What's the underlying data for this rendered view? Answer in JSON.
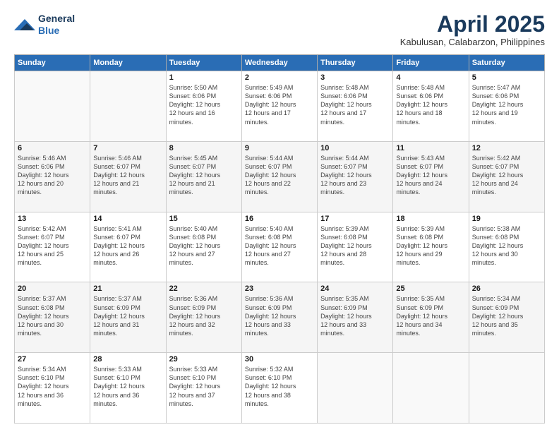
{
  "header": {
    "logo_line1": "General",
    "logo_line2": "Blue",
    "title": "April 2025",
    "location": "Kabulusan, Calabarzon, Philippines"
  },
  "weekdays": [
    "Sunday",
    "Monday",
    "Tuesday",
    "Wednesday",
    "Thursday",
    "Friday",
    "Saturday"
  ],
  "weeks": [
    [
      {
        "day": "",
        "info": ""
      },
      {
        "day": "",
        "info": ""
      },
      {
        "day": "1",
        "sunrise": "5:50 AM",
        "sunset": "6:06 PM",
        "daylight": "12 hours and 16 minutes."
      },
      {
        "day": "2",
        "sunrise": "5:49 AM",
        "sunset": "6:06 PM",
        "daylight": "12 hours and 17 minutes."
      },
      {
        "day": "3",
        "sunrise": "5:48 AM",
        "sunset": "6:06 PM",
        "daylight": "12 hours and 17 minutes."
      },
      {
        "day": "4",
        "sunrise": "5:48 AM",
        "sunset": "6:06 PM",
        "daylight": "12 hours and 18 minutes."
      },
      {
        "day": "5",
        "sunrise": "5:47 AM",
        "sunset": "6:06 PM",
        "daylight": "12 hours and 19 minutes."
      }
    ],
    [
      {
        "day": "6",
        "sunrise": "5:46 AM",
        "sunset": "6:06 PM",
        "daylight": "12 hours and 20 minutes."
      },
      {
        "day": "7",
        "sunrise": "5:46 AM",
        "sunset": "6:07 PM",
        "daylight": "12 hours and 21 minutes."
      },
      {
        "day": "8",
        "sunrise": "5:45 AM",
        "sunset": "6:07 PM",
        "daylight": "12 hours and 21 minutes."
      },
      {
        "day": "9",
        "sunrise": "5:44 AM",
        "sunset": "6:07 PM",
        "daylight": "12 hours and 22 minutes."
      },
      {
        "day": "10",
        "sunrise": "5:44 AM",
        "sunset": "6:07 PM",
        "daylight": "12 hours and 23 minutes."
      },
      {
        "day": "11",
        "sunrise": "5:43 AM",
        "sunset": "6:07 PM",
        "daylight": "12 hours and 24 minutes."
      },
      {
        "day": "12",
        "sunrise": "5:42 AM",
        "sunset": "6:07 PM",
        "daylight": "12 hours and 24 minutes."
      }
    ],
    [
      {
        "day": "13",
        "sunrise": "5:42 AM",
        "sunset": "6:07 PM",
        "daylight": "12 hours and 25 minutes."
      },
      {
        "day": "14",
        "sunrise": "5:41 AM",
        "sunset": "6:07 PM",
        "daylight": "12 hours and 26 minutes."
      },
      {
        "day": "15",
        "sunrise": "5:40 AM",
        "sunset": "6:08 PM",
        "daylight": "12 hours and 27 minutes."
      },
      {
        "day": "16",
        "sunrise": "5:40 AM",
        "sunset": "6:08 PM",
        "daylight": "12 hours and 27 minutes."
      },
      {
        "day": "17",
        "sunrise": "5:39 AM",
        "sunset": "6:08 PM",
        "daylight": "12 hours and 28 minutes."
      },
      {
        "day": "18",
        "sunrise": "5:39 AM",
        "sunset": "6:08 PM",
        "daylight": "12 hours and 29 minutes."
      },
      {
        "day": "19",
        "sunrise": "5:38 AM",
        "sunset": "6:08 PM",
        "daylight": "12 hours and 30 minutes."
      }
    ],
    [
      {
        "day": "20",
        "sunrise": "5:37 AM",
        "sunset": "6:08 PM",
        "daylight": "12 hours and 30 minutes."
      },
      {
        "day": "21",
        "sunrise": "5:37 AM",
        "sunset": "6:09 PM",
        "daylight": "12 hours and 31 minutes."
      },
      {
        "day": "22",
        "sunrise": "5:36 AM",
        "sunset": "6:09 PM",
        "daylight": "12 hours and 32 minutes."
      },
      {
        "day": "23",
        "sunrise": "5:36 AM",
        "sunset": "6:09 PM",
        "daylight": "12 hours and 33 minutes."
      },
      {
        "day": "24",
        "sunrise": "5:35 AM",
        "sunset": "6:09 PM",
        "daylight": "12 hours and 33 minutes."
      },
      {
        "day": "25",
        "sunrise": "5:35 AM",
        "sunset": "6:09 PM",
        "daylight": "12 hours and 34 minutes."
      },
      {
        "day": "26",
        "sunrise": "5:34 AM",
        "sunset": "6:09 PM",
        "daylight": "12 hours and 35 minutes."
      }
    ],
    [
      {
        "day": "27",
        "sunrise": "5:34 AM",
        "sunset": "6:10 PM",
        "daylight": "12 hours and 36 minutes."
      },
      {
        "day": "28",
        "sunrise": "5:33 AM",
        "sunset": "6:10 PM",
        "daylight": "12 hours and 36 minutes."
      },
      {
        "day": "29",
        "sunrise": "5:33 AM",
        "sunset": "6:10 PM",
        "daylight": "12 hours and 37 minutes."
      },
      {
        "day": "30",
        "sunrise": "5:32 AM",
        "sunset": "6:10 PM",
        "daylight": "12 hours and 38 minutes."
      },
      {
        "day": "",
        "info": ""
      },
      {
        "day": "",
        "info": ""
      },
      {
        "day": "",
        "info": ""
      }
    ]
  ]
}
